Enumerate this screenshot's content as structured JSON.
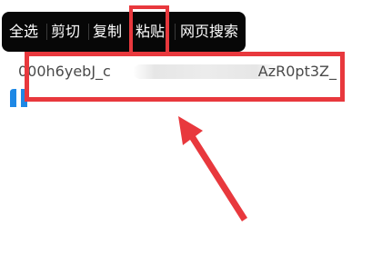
{
  "context_menu": {
    "items": [
      {
        "label": "全选"
      },
      {
        "label": "剪切"
      },
      {
        "label": "复制"
      },
      {
        "label": "粘贴"
      },
      {
        "label": "网页搜索"
      }
    ],
    "background_color": "#070707",
    "text_color": "#ffffff"
  },
  "text_field": {
    "value_prefix": "000h6yebJ_c",
    "value_suffix": "AzR0pt3Z_"
  },
  "annotations": {
    "highlight_color": "#e8383d",
    "accent_icon_color": "#1e88e5"
  }
}
